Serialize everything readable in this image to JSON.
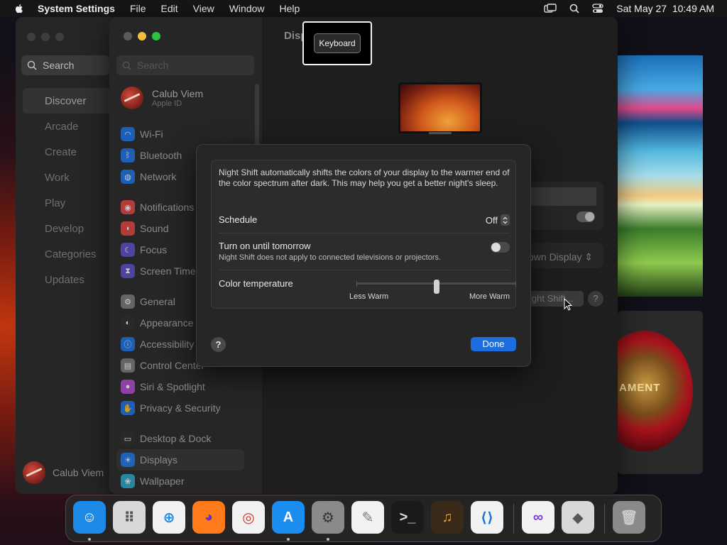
{
  "menubar": {
    "app_name": "System Settings",
    "menus": [
      "File",
      "Edit",
      "View",
      "Window",
      "Help"
    ],
    "datetime": "Sat May 27  10:49 AM",
    "icons": [
      "screen-mirroring-icon",
      "spotlight-search-icon",
      "control-center-icon"
    ]
  },
  "appstore": {
    "search_label": "Search",
    "nav": [
      "Discover",
      "Arcade",
      "Create",
      "Work",
      "Play",
      "Develop",
      "Categories",
      "Updates"
    ],
    "selected_nav": "Discover",
    "user_name": "Calub Viem"
  },
  "settings": {
    "search_placeholder": "Search",
    "user_name": "Calub Viem",
    "user_sub": "Apple ID",
    "main_title": "Disp",
    "sidebar_groups": [
      [
        {
          "label": "Wi-Fi",
          "icon": "wifi-icon",
          "color": "#1a73e8"
        },
        {
          "label": "Bluetooth",
          "icon": "bluetooth-icon",
          "color": "#1a73e8"
        },
        {
          "label": "Network",
          "icon": "globe-icon",
          "color": "#1a73e8"
        }
      ],
      [
        {
          "label": "Notifications",
          "icon": "bell-icon",
          "color": "#e0443e"
        },
        {
          "label": "Sound",
          "icon": "speaker-icon",
          "color": "#e0443e"
        },
        {
          "label": "Focus",
          "icon": "moon-icon",
          "color": "#5b4fc9"
        },
        {
          "label": "Screen Time",
          "icon": "hourglass-icon",
          "color": "#5b4fc9"
        }
      ],
      [
        {
          "label": "General",
          "icon": "gear-icon",
          "color": "#7a7a7a"
        },
        {
          "label": "Appearance",
          "icon": "appearance-icon",
          "color": "#2a2a2a"
        },
        {
          "label": "Accessibility",
          "icon": "accessibility-icon",
          "color": "#1a73e8"
        },
        {
          "label": "Control Center",
          "icon": "control-center-icon",
          "color": "#7a7a7a"
        },
        {
          "label": "Siri & Spotlight",
          "icon": "siri-icon",
          "color": "#b04ad0"
        },
        {
          "label": "Privacy & Security",
          "icon": "hand-icon",
          "color": "#1a73e8"
        }
      ],
      [
        {
          "label": "Desktop & Dock",
          "icon": "dock-icon",
          "color": "#2a2a2a"
        },
        {
          "label": "Displays",
          "icon": "sun-icon",
          "color": "#1a73e8"
        },
        {
          "label": "Wallpaper",
          "icon": "wallpaper-icon",
          "color": "#2aa8c8"
        }
      ]
    ],
    "selected_item": "Displays",
    "display_select_text": "own Display",
    "night_shift_button": "ight Shift...",
    "help_label": "?"
  },
  "tooltip": {
    "text": "Keyboard"
  },
  "night_shift": {
    "description": "Night Shift automatically shifts the colors of your display to the warmer end of the color spectrum after dark. This may help you get a better night's sleep.",
    "schedule_label": "Schedule",
    "schedule_value": "Off",
    "turn_on_label": "Turn on until tomorrow",
    "turn_on_sub": "Night Shift does not apply to connected televisions or projectors.",
    "turn_on_enabled": false,
    "color_temp_label": "Color temperature",
    "less_warm": "Less Warm",
    "more_warm": "More Warm",
    "color_temp_level": 0.5,
    "help_label": "?",
    "done_label": "Done"
  },
  "dock": {
    "apps": [
      {
        "name": "finder-icon",
        "running": true,
        "color": "#1e8ae8"
      },
      {
        "name": "launchpad-icon",
        "running": false,
        "color": "#d8d8d8"
      },
      {
        "name": "safari-icon",
        "running": false,
        "color": "#f2f2f2"
      },
      {
        "name": "firefox-icon",
        "running": false,
        "color": "#ff7a18"
      },
      {
        "name": "chrome-icon",
        "running": false,
        "color": "#f2f2f2"
      },
      {
        "name": "app-store-icon",
        "running": true,
        "color": "#1b8cf0"
      },
      {
        "name": "system-settings-icon",
        "running": true,
        "color": "#8a8a8a"
      },
      {
        "name": "textedit-icon",
        "running": false,
        "color": "#f2f2f2"
      },
      {
        "name": "terminal-icon",
        "running": false,
        "color": "#1a1a1a"
      },
      {
        "name": "garageband-icon",
        "running": false,
        "color": "#3a2a1a"
      },
      {
        "name": "vscode-icon",
        "running": false,
        "color": "#f2f2f2"
      },
      {
        "name": "visual-studio-icon",
        "running": false,
        "color": "#f2f2f2"
      },
      {
        "name": "boot-camp-icon",
        "running": false,
        "color": "#d8d8d8"
      },
      {
        "name": "trash-icon",
        "running": false,
        "color": "#8a8a8a"
      }
    ]
  }
}
